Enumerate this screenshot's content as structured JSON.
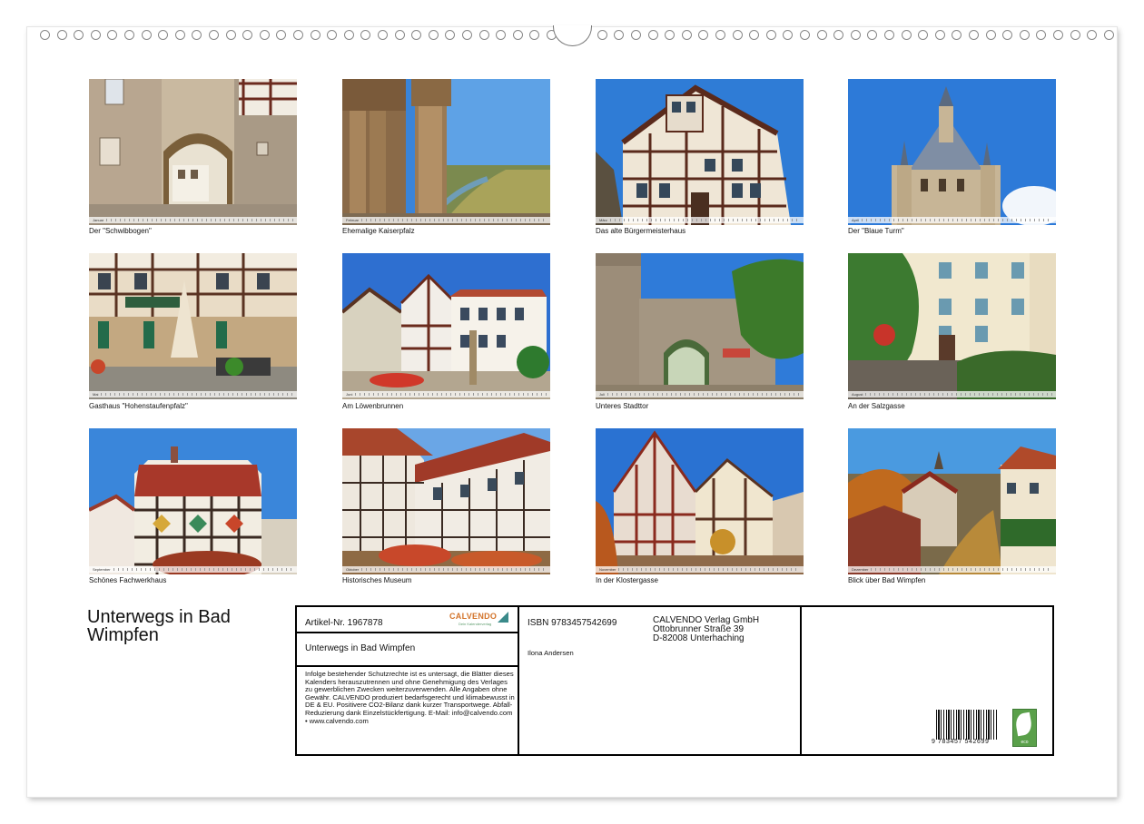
{
  "calendar": {
    "title": "Unterwegs in Bad Wimpfen",
    "months": [
      {
        "label": "Januar",
        "caption": "Der \"Schwibbogen\""
      },
      {
        "label": "Februar",
        "caption": "Ehemalige Kaiserpfalz"
      },
      {
        "label": "März",
        "caption": "Das alte Bürgermeisterhaus"
      },
      {
        "label": "April",
        "caption": "Der \"Blaue Turm\""
      },
      {
        "label": "Mai",
        "caption": "Gasthaus \"Hohenstaufenpfalz\""
      },
      {
        "label": "Juni",
        "caption": "Am Löwenbrunnen"
      },
      {
        "label": "Juli",
        "caption": "Unteres Stadttor"
      },
      {
        "label": "August",
        "caption": "An der Salzgasse"
      },
      {
        "label": "September",
        "caption": "Schönes Fachwerkhaus"
      },
      {
        "label": "Oktober",
        "caption": "Historisches Museum"
      },
      {
        "label": "November",
        "caption": "In der Klostergasse"
      },
      {
        "label": "Dezember",
        "caption": "Blick über Bad Wimpfen"
      }
    ]
  },
  "imprint": {
    "article_number": "Artikel-Nr. 1967878",
    "product_title": "Unterwegs in Bad Wimpfen",
    "logo": "CALVENDO",
    "logo_sub": "Dein Kalenderverlag",
    "legal_text": "Infolge bestehender Schutzrechte ist es untersagt, die Blätter dieses Kalenders herauszutrennen und ohne Genehmigung des Verlages zu gewerblichen Zwecken weiterzuverwenden. Alle Angaben ohne Gewähr. CALVENDO produziert bedarfsgerecht und klimabewusst in DE & EU. Positivere CO2-Bilanz dank kurzer Transportwege. Abfall-Reduzierung dank Einzelstückfertigung. E-Mail: info@calvendo.com • www.calvendo.com",
    "isbn": "ISBN 9783457542699",
    "author": "Ilona Andersen",
    "publisher_lines": [
      "CALVENDO Verlag GmbH",
      "Ottobrunner Straße 39",
      "D-82008 Unterhaching"
    ],
    "barcode_text": "9 783457 542699",
    "eco_label": "eco"
  }
}
